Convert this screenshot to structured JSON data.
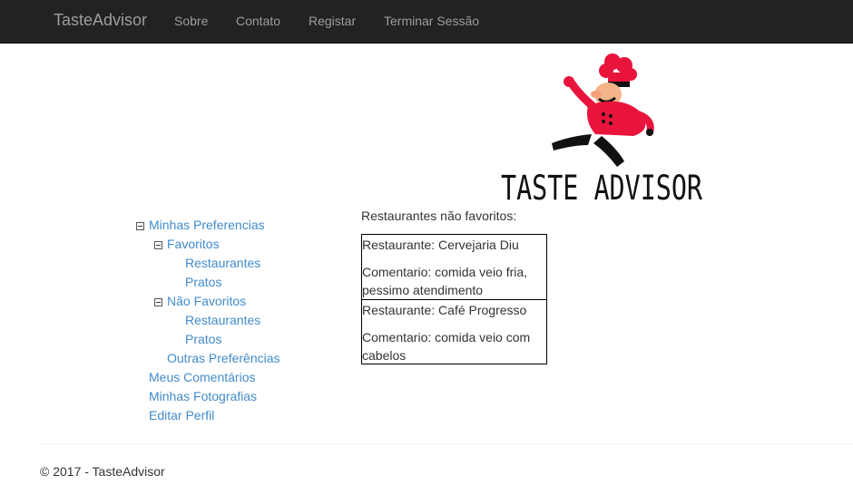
{
  "navbar": {
    "brand": "TasteAdvisor",
    "links": [
      "Sobre",
      "Contato",
      "Registar",
      "Terminar Sessão"
    ]
  },
  "logo": {
    "text": "TASTE ADVISOR",
    "icon": "chef-mascot-icon"
  },
  "sidebar": {
    "root_label": "Minhas Preferencias",
    "favoritos_label": "Favoritos",
    "favoritos_items": [
      "Restaurantes",
      "Pratos"
    ],
    "nao_favoritos_label": "Não Favoritos",
    "nao_favoritos_items": [
      "Restaurantes",
      "Pratos"
    ],
    "outras_label": "Outras Preferências",
    "links": [
      "Meus Comentários",
      "Minhas Fotografias",
      "Editar Perfil"
    ]
  },
  "content": {
    "title": "Restaurantes não favoritos:",
    "restaurants": [
      {
        "name": "Restaurante: Cervejaria Diu",
        "comment": "Comentario: comida veio fria, pessimo atendimento"
      },
      {
        "name": "Restaurante: Café Progresso",
        "comment": "Comentario: comida veio com cabelos"
      }
    ]
  },
  "footer": {
    "text": "© 2017 - TasteAdvisor"
  },
  "colors": {
    "navbar_bg": "#222222",
    "link": "#428bca",
    "nav_text": "#9d9d9d",
    "chef_red": "#e8143c"
  }
}
